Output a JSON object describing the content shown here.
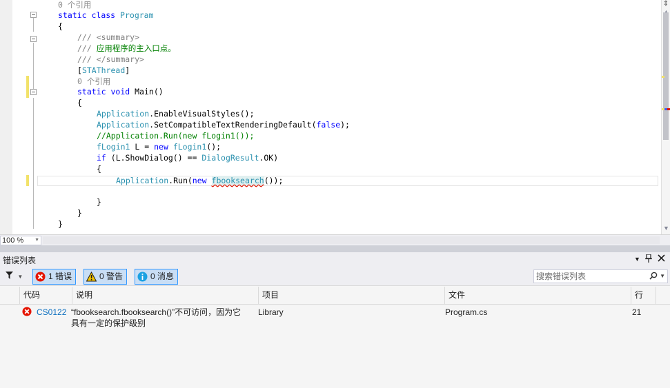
{
  "editor": {
    "lens_ref_1": "0 个引用",
    "lens_ref_2": "0 个引用",
    "code": {
      "kw_static": "static",
      "kw_class": "class",
      "class_name": "Program",
      "brace_open": "{",
      "brace_close": "}",
      "doc_slashes": "///",
      "doc_summary_open": "<summary>",
      "doc_summary_text": "应用程序的主入口点。",
      "doc_summary_close": "</summary>",
      "attr_open": "[",
      "attr_name": "STAThread",
      "attr_close": "]",
      "kw_void": "void",
      "method_sig": "Main()",
      "app": "Application",
      "call_evs": ".EnableVisualStyles();",
      "call_sctrd": ".SetCompatibleTextRenderingDefault(",
      "kw_false": "false",
      "close_paren_semi": ");",
      "comment_line": "//Application.Run(new fLogin1());",
      "type_flogin": "fLogin1",
      "var_decl": " L = ",
      "kw_new": "new",
      "ctor_call": "();",
      "kw_if": "if",
      "if_cond_a": " (L.ShowDialog() == ",
      "type_dialogresult": "DialogResult",
      "if_cond_b": ".OK)",
      "call_run": ".Run(",
      "type_fbooksearch": "fbooksearch",
      "run_close": "());"
    }
  },
  "zoom": {
    "value": "100 %"
  },
  "error_list": {
    "title": "错误列表",
    "filters": {
      "errors_label": "1 错误",
      "warnings_label": "0 警告",
      "messages_label": "0 消息"
    },
    "search_placeholder": "搜索错误列表",
    "columns": {
      "code": "代码",
      "description": "说明",
      "project": "项目",
      "file": "文件",
      "line": "行"
    },
    "rows": [
      {
        "code": "CS0122",
        "description_line1": "“fbooksearch.fbooksearch()”不可访问，因为它",
        "description_line2": "具有一定的保护级别",
        "project": "Library",
        "file": "Program.cs",
        "line": "21"
      }
    ]
  },
  "colors": {
    "keyword": "#0000ff",
    "type": "#2b91af",
    "comment": "#008000",
    "error": "#e51400",
    "accent": "#3399ff"
  },
  "icons": [
    "filter-icon",
    "error-icon",
    "warning-icon",
    "info-icon",
    "search-icon",
    "pin-icon",
    "close-icon",
    "dropdown-icon",
    "split-icon"
  ]
}
